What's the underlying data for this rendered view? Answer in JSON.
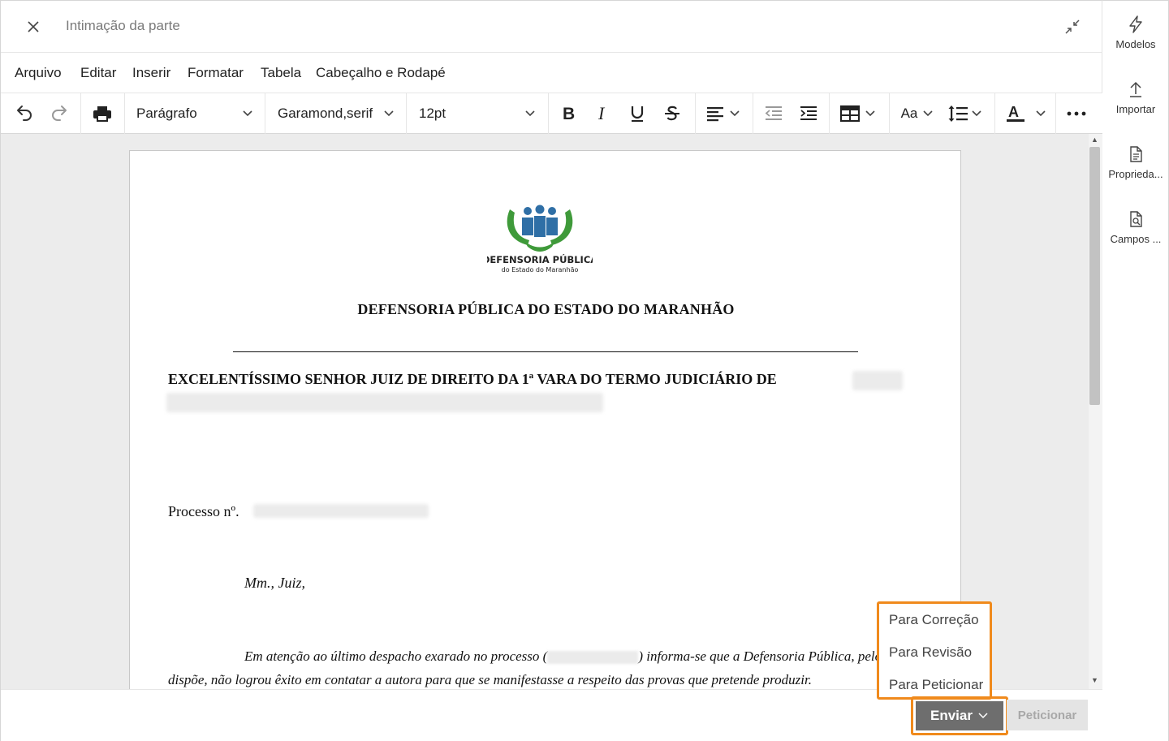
{
  "header": {
    "title": "Intimação da parte"
  },
  "menu": {
    "items": [
      "Arquivo",
      "Editar",
      "Inserir",
      "Formatar",
      "Tabela",
      "Cabeçalho e Rodapé"
    ]
  },
  "toolbar": {
    "block_format": "Parágrafo",
    "font_family": "Garamond,serif",
    "font_size": "12pt",
    "case_label": "Aa"
  },
  "document": {
    "logo_text_line1": "DEFENSORIA PÚBLICA",
    "logo_text_line2": "do Estado do Maranhão",
    "org_title": "DEFENSORIA PÚBLICA DO ESTADO DO MARANHÃO",
    "addressee": "EXCELENTÍSSIMO SENHOR JUIZ DE DIREITO DA 1ª VARA DO TERMO JUDICIÁRIO DE",
    "processo_label": "Processo nº.",
    "salutation": "Mm., Juiz,",
    "paragraph_1a": "Em atenção ao último despacho exarado no processo (",
    "paragraph_1b": ") informa-se que a Defensoria Pública, pelos m",
    "paragraph_2": "dispõe, não logrou êxito em contatar a autora para que se manifestasse a respeito das provas que pretende produzir."
  },
  "send_menu": {
    "options": [
      "Para Correção",
      "Para Revisão",
      "Para Peticionar"
    ]
  },
  "actions": {
    "send_label": "Enviar",
    "petition_label": "Peticionar"
  },
  "sidebar": {
    "items": [
      {
        "label": "Modelos",
        "icon": "lightning-icon"
      },
      {
        "label": "Importar",
        "icon": "upload-icon"
      },
      {
        "label": "Proprieda...",
        "icon": "document-properties-icon"
      },
      {
        "label": "Campos ...",
        "icon": "document-search-icon"
      }
    ]
  },
  "colors": {
    "highlight": "#f08a1c",
    "send_button": "#6e6e6e",
    "logo_green": "#3f9a3a",
    "logo_blue": "#2f6fa6"
  }
}
